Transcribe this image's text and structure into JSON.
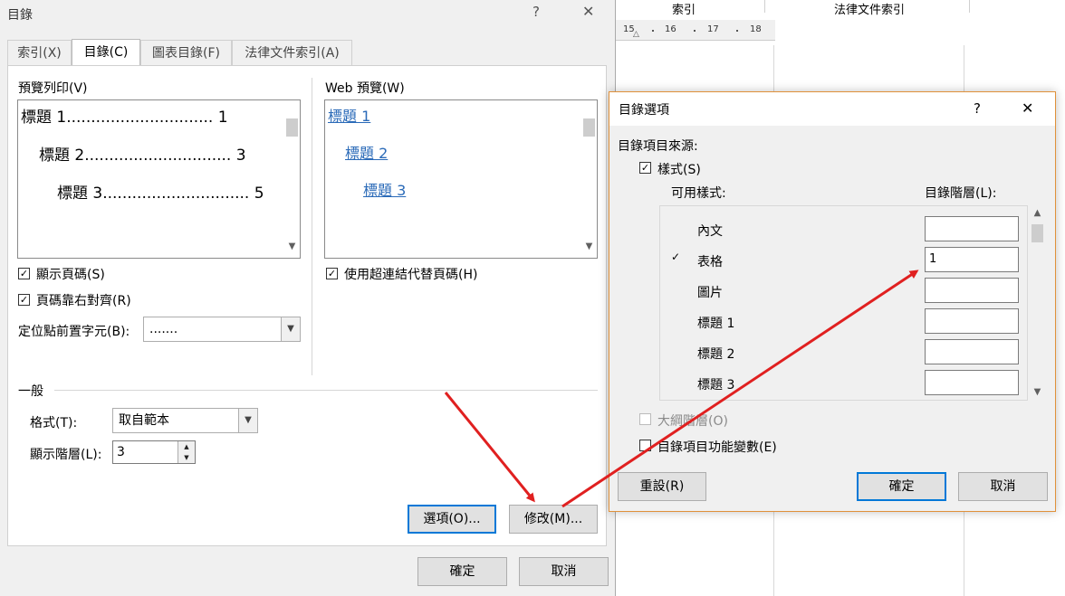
{
  "background_doc": {
    "tabs": [
      "索引",
      "法律文件索引"
    ],
    "ruler_numbers": [
      "15",
      "16",
      "17",
      "18"
    ]
  },
  "main_dialog": {
    "title": "目錄",
    "help_glyph": "?",
    "close_glyph": "✕",
    "tabs": [
      {
        "label": "索引(X)"
      },
      {
        "label": "目錄(C)"
      },
      {
        "label": "圖表目錄(F)"
      },
      {
        "label": "法律文件索引(A)"
      }
    ],
    "print_preview": {
      "label": "預覽列印(V)",
      "entries": [
        "標題 1.............................. 1",
        "標題 2.............................. 3",
        "標題 3.............................. 5"
      ]
    },
    "web_preview": {
      "label": "Web 預覽(W)",
      "entries": [
        "標題 1",
        "標題 2",
        "標題 3"
      ]
    },
    "show_page_numbers": {
      "label": "顯示頁碼(S)",
      "checked": true
    },
    "right_align_page_numbers": {
      "label": "頁碼靠右對齊(R)",
      "checked": true
    },
    "use_hyperlinks": {
      "label": "使用超連結代替頁碼(H)",
      "checked": true
    },
    "tab_leader": {
      "label": "定位點前置字元(B):",
      "value": "......."
    },
    "general": {
      "section_label": "一般",
      "formats": {
        "label": "格式(T):",
        "value": "取自範本"
      },
      "show_levels": {
        "label": "顯示階層(L):",
        "value": "3"
      }
    },
    "options_button": "選項(O)...",
    "modify_button": "修改(M)...",
    "ok_button": "確定",
    "cancel_button": "取消"
  },
  "options_dialog": {
    "title": "目錄選項",
    "help_glyph": "?",
    "close_glyph": "✕",
    "build_from_label": "目錄項目來源:",
    "styles_checkbox": {
      "label": "樣式(S)",
      "checked": true
    },
    "available_styles_header": "可用樣式:",
    "toc_level_header": "目錄階層(L):",
    "styles": [
      {
        "name": "內文",
        "level": "",
        "in_use": false
      },
      {
        "name": "表格",
        "level": "1",
        "in_use": true
      },
      {
        "name": "圖片",
        "level": "",
        "in_use": false
      },
      {
        "name": "標題 1",
        "level": "",
        "in_use": false
      },
      {
        "name": "標題 2",
        "level": "",
        "in_use": false
      },
      {
        "name": "標題 3",
        "level": "",
        "in_use": false
      }
    ],
    "in_use_glyph": "✓",
    "outline_levels": {
      "label": "大綱階層(O)",
      "checked": false,
      "enabled": false
    },
    "entry_fields": {
      "label": "目錄項目功能變數(E)",
      "checked": false
    },
    "reset_button": "重設(R)",
    "ok_button": "確定",
    "cancel_button": "取消"
  },
  "annotation_color": "#e02020"
}
